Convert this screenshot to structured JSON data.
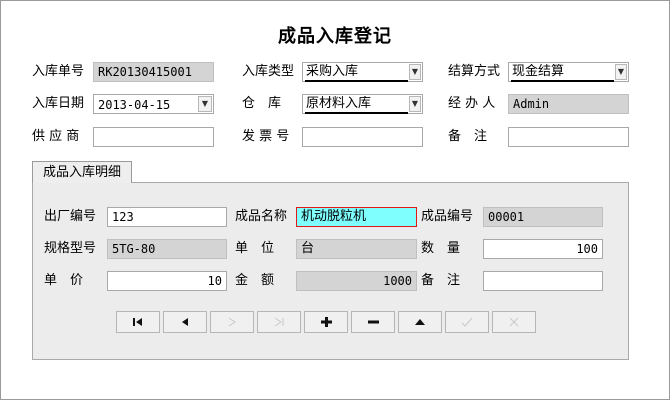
{
  "title": "成品入库登记",
  "header": {
    "receipt_no": {
      "label": "入库单号",
      "value": "RK20130415001"
    },
    "receipt_type": {
      "label": "入库类型",
      "value": "采购入库"
    },
    "settlement": {
      "label": "结算方式",
      "value": "现金结算"
    },
    "receipt_date": {
      "label": "入库日期",
      "value": "2013-04-15"
    },
    "warehouse": {
      "label": "仓　库",
      "value": "原材料入库"
    },
    "handler": {
      "label": "经 办 人",
      "value": "Admin"
    },
    "supplier": {
      "label": "供 应 商",
      "value": ""
    },
    "invoice_no": {
      "label": "发 票 号",
      "value": ""
    },
    "remark": {
      "label": "备　注",
      "value": ""
    }
  },
  "tab": {
    "label": "成品入库明细"
  },
  "detail": {
    "factory_no": {
      "label": "出厂编号",
      "value": "123"
    },
    "product_name": {
      "label": "成品名称",
      "value": "机动脱粒机"
    },
    "product_code": {
      "label": "成品编号",
      "value": "00001"
    },
    "spec": {
      "label": "规格型号",
      "value": "5TG-80"
    },
    "unit": {
      "label": "单　位",
      "value": "台"
    },
    "quantity": {
      "label": "数　量",
      "value": "100"
    },
    "unit_price": {
      "label": "单　价",
      "value": "10"
    },
    "amount": {
      "label": "金　额",
      "value": "1000"
    },
    "remark": {
      "label": "备　注",
      "value": ""
    }
  },
  "navigator": [
    {
      "icon": "first-record-icon",
      "enabled": true
    },
    {
      "icon": "prior-record-icon",
      "enabled": true
    },
    {
      "icon": "next-record-icon",
      "enabled": false
    },
    {
      "icon": "last-record-icon",
      "enabled": false
    },
    {
      "icon": "insert-record-icon",
      "enabled": true
    },
    {
      "icon": "delete-record-icon",
      "enabled": true
    },
    {
      "icon": "edit-record-icon",
      "enabled": true
    },
    {
      "icon": "post-edit-icon",
      "enabled": false
    },
    {
      "icon": "cancel-edit-icon",
      "enabled": false
    }
  ],
  "colors": {
    "panel_bg": "#ececec",
    "readonly_bg": "#d4d4d4",
    "highlight_bg": "#80ffff",
    "highlight_border": "#e01818"
  }
}
